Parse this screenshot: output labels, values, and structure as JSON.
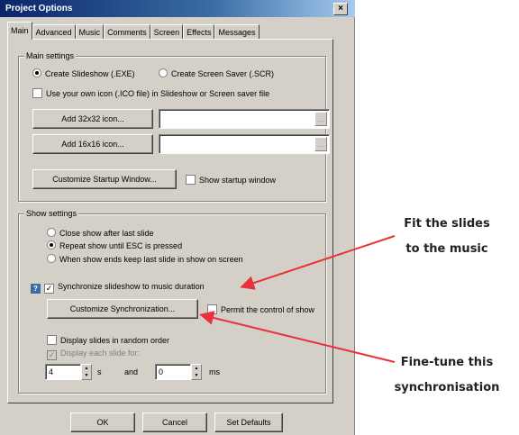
{
  "window": {
    "title": "Project Options",
    "close_glyph": "×"
  },
  "tabs": [
    "Main",
    "Advanced",
    "Music",
    "Comments",
    "Screen",
    "Effects",
    "Messages"
  ],
  "main_settings": {
    "title": "Main settings",
    "radio_exe": "Create Slideshow (.EXE)",
    "radio_scr": "Create Screen Saver (.SCR)",
    "use_icon_label": "Use your own icon (.ICO file) in Slideshow or Screen saver file",
    "add32_label": "Add 32x32 icon...",
    "add16_label": "Add 16x16 icon...",
    "browse_glyph": "...",
    "customize_startup_label": "Customize Startup Window...",
    "show_startup_label": "Show startup window"
  },
  "show_settings": {
    "title": "Show settings",
    "radio_close": "Close show after last slide",
    "radio_repeat": "Repeat show until ESC is pressed",
    "radio_keep": "When show ends keep last slide in show on screen",
    "sync_label": "Synchronize slideshow to music duration",
    "customize_sync_label": "Customize Synchronization...",
    "permit_label": "Permit the control of show",
    "random_label": "Display slides in random order",
    "each_slide_label": "Display each slide for:",
    "seconds_value": "4",
    "seconds_unit": "s",
    "and_label": "and",
    "ms_value": "0",
    "ms_unit": "ms",
    "check_glyph": "✓"
  },
  "footer": {
    "ok": "OK",
    "cancel": "Cancel",
    "defaults": "Set Defaults"
  },
  "annotations": {
    "fit_line1": "Fit the slides",
    "fit_line2": "to the music",
    "fine_line1": "Fine-tune this",
    "fine_line2": "synchronisation",
    "arrow_color": "#e8323c"
  }
}
